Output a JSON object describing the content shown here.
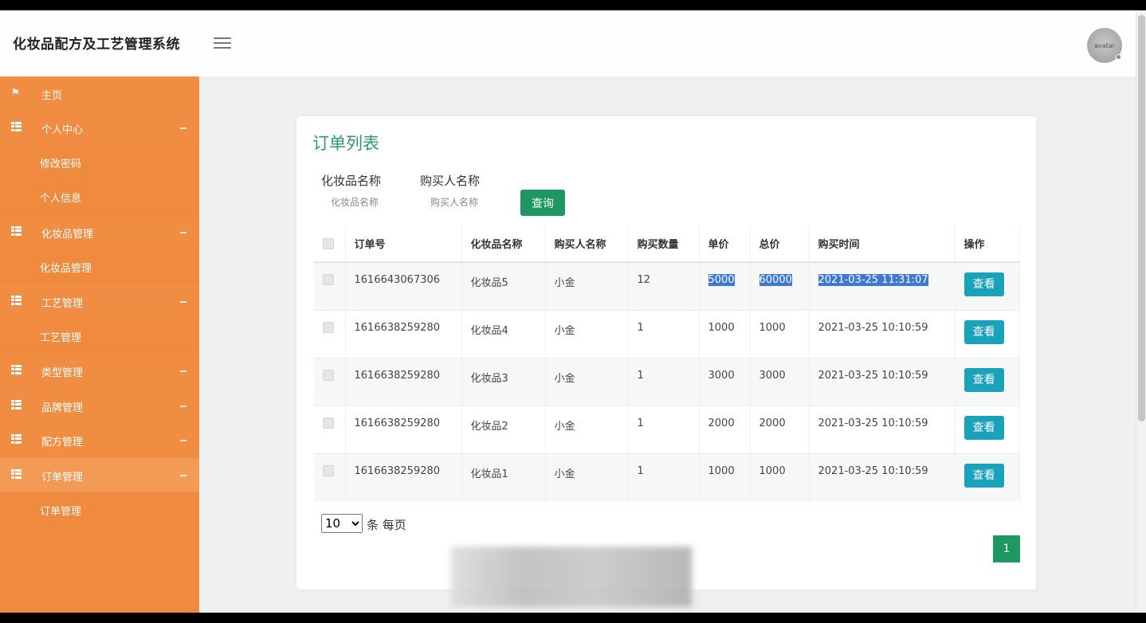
{
  "app": {
    "title": "化妆品配方及工艺管理系统",
    "avatar_text": "avatar"
  },
  "sidebar": {
    "items": [
      {
        "label": "主页",
        "type": "group",
        "icon": "flag-icon"
      },
      {
        "label": "个人中心",
        "type": "group",
        "icon": "grid-icon"
      },
      {
        "label": "修改密码",
        "type": "sub"
      },
      {
        "label": "个人信息",
        "type": "sub"
      },
      {
        "label": "化妆品管理",
        "type": "group",
        "icon": "grid-icon"
      },
      {
        "label": "化妆品管理",
        "type": "sub"
      },
      {
        "label": "工艺管理",
        "type": "group",
        "icon": "grid-icon"
      },
      {
        "label": "工艺管理",
        "type": "sub"
      },
      {
        "label": "类型管理",
        "type": "group",
        "icon": "grid-icon"
      },
      {
        "label": "品牌管理",
        "type": "group",
        "icon": "grid-icon"
      },
      {
        "label": "配方管理",
        "type": "group",
        "icon": "grid-icon"
      },
      {
        "label": "订单管理",
        "type": "group",
        "icon": "grid-icon"
      },
      {
        "label": "订单管理",
        "type": "sub"
      }
    ]
  },
  "page": {
    "title": "订单列表",
    "filters": {
      "product_label": "化妆品名称",
      "product_placeholder": "化妆品名称",
      "buyer_label": "购买人名称",
      "buyer_placeholder": "购买人名称",
      "query_label": "查询"
    },
    "table": {
      "headers": [
        "订单号",
        "化妆品名称",
        "购买人名称",
        "购买数量",
        "单价",
        "总价",
        "购买时间",
        "操作"
      ],
      "rows": [
        {
          "order_no": "1616643067306",
          "product": "化妆品5",
          "buyer": "小金",
          "qty": "12",
          "price": "5000",
          "total": "60000",
          "time": "2021-03-25 11:31:07",
          "action": "查看"
        },
        {
          "order_no": "1616638259280",
          "product": "化妆品4",
          "buyer": "小金",
          "qty": "1",
          "price": "1000",
          "total": "1000",
          "time": "2021-03-25 10:10:59",
          "action": "查看"
        },
        {
          "order_no": "1616638259280",
          "product": "化妆品3",
          "buyer": "小金",
          "qty": "1",
          "price": "3000",
          "total": "3000",
          "time": "2021-03-25 10:10:59",
          "action": "查看"
        },
        {
          "order_no": "1616638259280",
          "product": "化妆品2",
          "buyer": "小金",
          "qty": "1",
          "price": "2000",
          "total": "2000",
          "time": "2021-03-25 10:10:59",
          "action": "查看"
        },
        {
          "order_no": "1616638259280",
          "product": "化妆品1",
          "buyer": "小金",
          "qty": "1",
          "price": "1000",
          "total": "1000",
          "time": "2021-03-25 10:10:59",
          "action": "查看"
        }
      ]
    },
    "pagination": {
      "page_size": "10",
      "page_size_suffix": "条 每页",
      "current_page": "1"
    }
  },
  "colors": {
    "sidebar": "#ef8a3e",
    "accent_green": "#1e9762",
    "view_button": "#1aa2ba",
    "title_green": "#2e9a6c"
  }
}
